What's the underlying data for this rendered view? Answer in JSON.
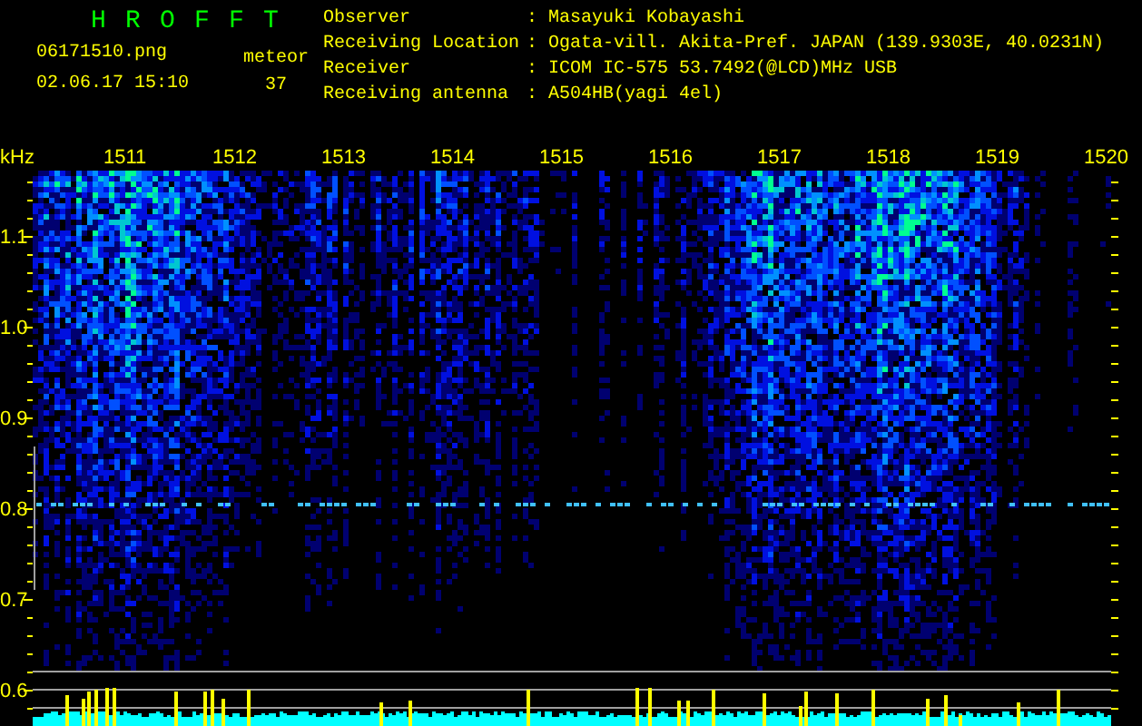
{
  "app": {
    "title": "H R O F F T"
  },
  "file": {
    "name": "06171510.png",
    "timestamp": "02.06.17 15:10"
  },
  "meteor": {
    "label": "meteor",
    "count": "37"
  },
  "info": [
    {
      "label": "Observer",
      "separator": ":",
      "value": "Masayuki Kobayashi"
    },
    {
      "label": "Receiving Location",
      "separator": ":",
      "value": "Ogata-vill. Akita-Pref. JAPAN (139.9303E, 40.0231N)"
    },
    {
      "label": "Receiver",
      "separator": ":",
      "value": "ICOM IC-575 53.7492(@LCD)MHz USB"
    },
    {
      "label": "Receiving antenna",
      "separator": ":",
      "value": "A504HB(yagi 4el)"
    }
  ],
  "spectrogram": {
    "y_unit": "kHz",
    "y_labels": [
      "1.1",
      "1.0",
      "0.9",
      "0.8",
      "0.7",
      "0.6"
    ],
    "time_labels": [
      "1511",
      "1512",
      "1513",
      "1514",
      "1515",
      "1516",
      "1517",
      "1518",
      "1519",
      "1520"
    ]
  }
}
